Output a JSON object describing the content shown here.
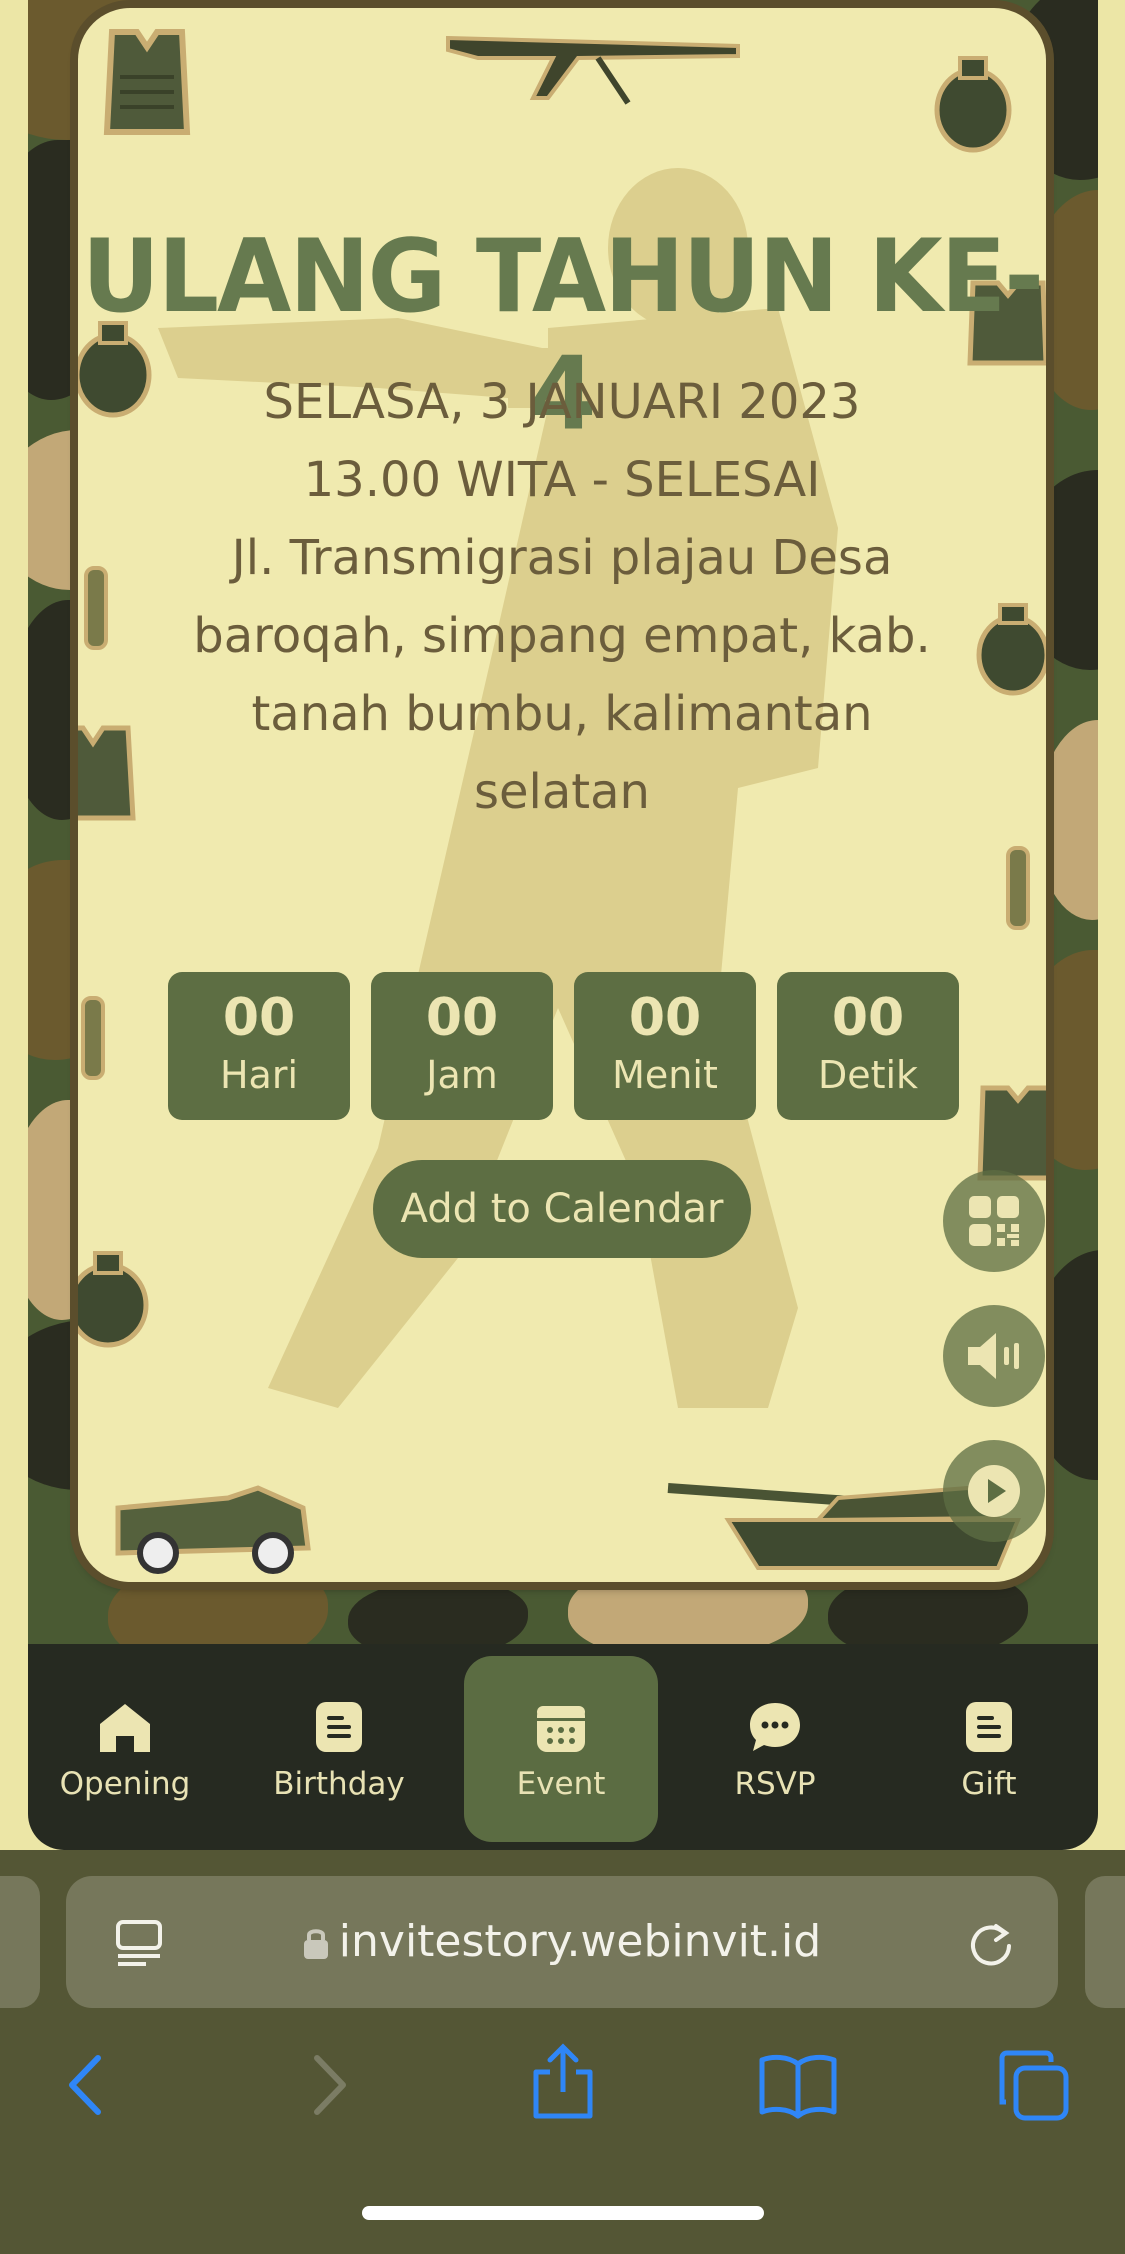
{
  "invitation": {
    "title": "ULANG TAHUN KE-4",
    "date": "SELASA, 3 JANUARI 2023",
    "time": "13.00 WITA - SELESAI",
    "address_lines": [
      "Jl. Transmigrasi plajau Desa",
      "baroqah, simpang empat, kab.",
      "tanah bumbu, kalimantan",
      "selatan"
    ]
  },
  "countdown": [
    {
      "value": "00",
      "label": "Hari"
    },
    {
      "value": "00",
      "label": "Jam"
    },
    {
      "value": "00",
      "label": "Menit"
    },
    {
      "value": "00",
      "label": "Detik"
    }
  ],
  "add_to_calendar_label": "Add to Calendar",
  "floating_buttons": [
    "qr-code-icon",
    "speaker-icon",
    "play-icon"
  ],
  "nav": {
    "items": [
      {
        "label": "Opening",
        "icon": "home-icon"
      },
      {
        "label": "Birthday",
        "icon": "document-icon"
      },
      {
        "label": "Event",
        "icon": "calendar-icon"
      },
      {
        "label": "RSVP",
        "icon": "chat-icon"
      },
      {
        "label": "Gift",
        "icon": "document-icon"
      }
    ],
    "active": "Event"
  },
  "browser": {
    "url": "invitestory.webinvit.id"
  },
  "colors": {
    "card_bg": "#f0eaaf",
    "accent_green": "#5d6e43",
    "title_green": "#667a4f",
    "text_brown": "#6b5d3c",
    "nav_bg": "#262a21",
    "browser_bg": "#545635",
    "ios_blue": "#2f86f7"
  }
}
